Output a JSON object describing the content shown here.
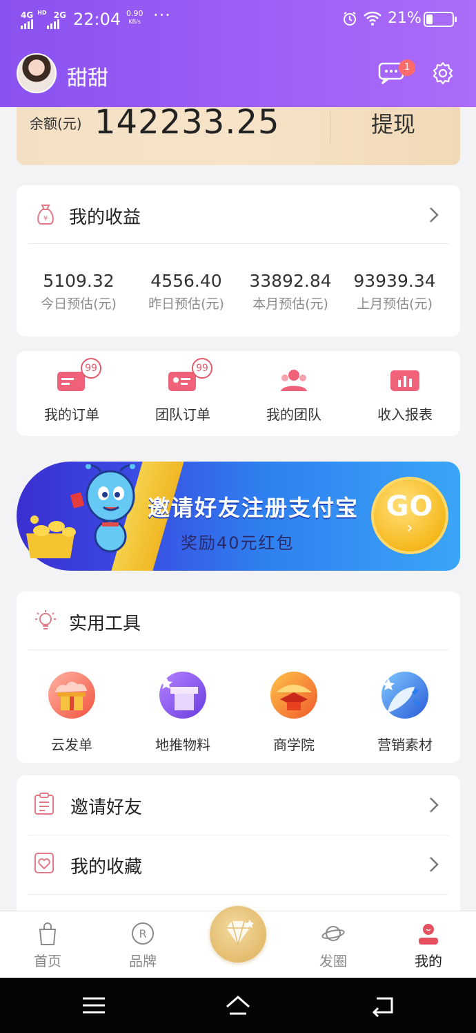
{
  "status_bar": {
    "network_1": "4G",
    "network_1_sup": "HD",
    "network_2": "2G",
    "time": "22:04",
    "speed_value": "0.90",
    "speed_unit": "KB/s",
    "dots": "···",
    "battery": "21%"
  },
  "profile": {
    "username": "甜甜",
    "message_badge": "1"
  },
  "balance": {
    "label": "余额(元)",
    "amount": "142233.25",
    "withdraw_label": "提现"
  },
  "earnings": {
    "title": "我的收益",
    "stats": [
      {
        "value": "5109.32",
        "label": "今日预估(元)"
      },
      {
        "value": "4556.40",
        "label": "昨日预估(元)"
      },
      {
        "value": "33892.84",
        "label": "本月预估(元)"
      },
      {
        "value": "93939.34",
        "label": "上月预估(元)"
      }
    ]
  },
  "quick_actions": [
    {
      "label": "我的订单",
      "badge": "99"
    },
    {
      "label": "团队订单",
      "badge": "99"
    },
    {
      "label": "我的团队"
    },
    {
      "label": "收入报表"
    }
  ],
  "banner": {
    "title": "邀请好友注册支付宝",
    "subtitle": "奖励40元红包",
    "go_label": "GO",
    "go_arrow": "›"
  },
  "tools": {
    "title": "实用工具",
    "items": [
      {
        "label": "云发单"
      },
      {
        "label": "地推物料"
      },
      {
        "label": "商学院"
      },
      {
        "label": "营销素材"
      }
    ]
  },
  "menu": [
    {
      "label": "邀请好友"
    },
    {
      "label": "我的收藏"
    }
  ],
  "tabbar": [
    {
      "label": "首页",
      "active": false
    },
    {
      "label": "品牌",
      "active": false
    },
    {
      "label": "发圈",
      "active": false
    },
    {
      "label": "我的",
      "active": true
    }
  ],
  "colors": {
    "header_gradient_start": "#8a52f0",
    "header_gradient_end": "#ab6cf9",
    "accent_pink": "#e45a6b",
    "balance_gold": "#f3dfc3",
    "page_bg": "#f3f3f5"
  },
  "icons": {
    "message": "chat-bubble-icon",
    "settings": "gear-icon",
    "earnings": "money-bag-icon",
    "tools": "lightbulb-icon",
    "invite": "clipboard-icon",
    "favorites": "heart-icon",
    "arrow": "chevron-right-icon"
  }
}
